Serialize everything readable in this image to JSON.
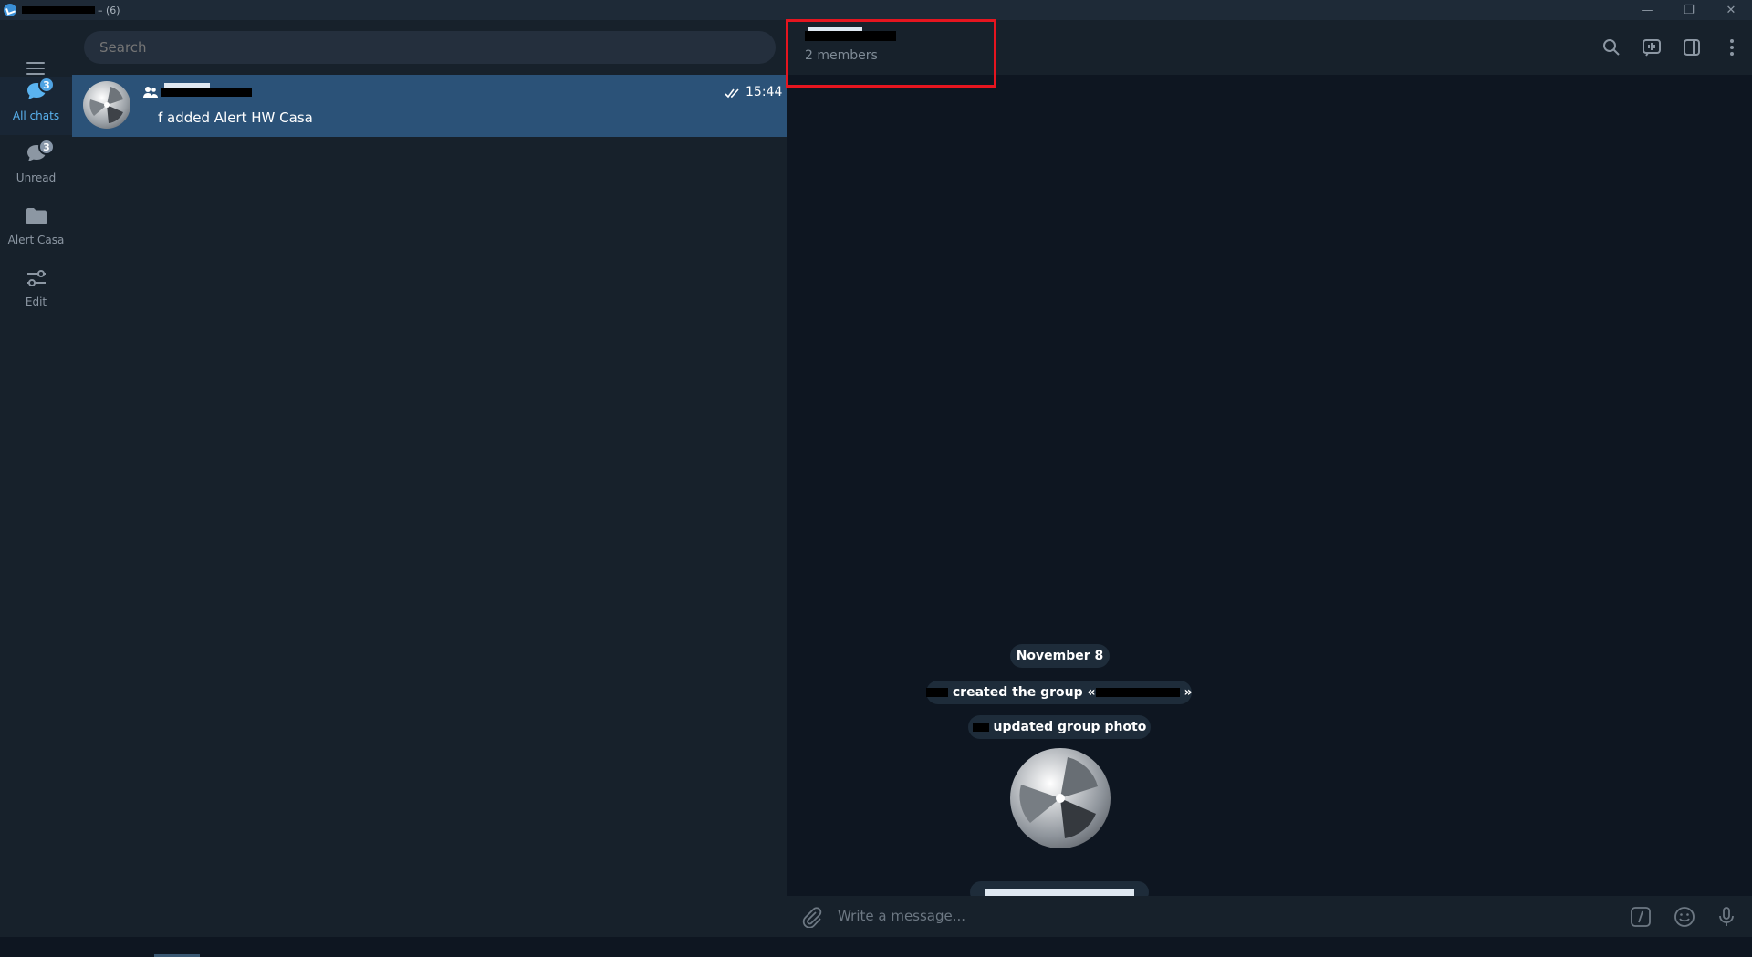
{
  "window": {
    "title_suffix": "– (6)",
    "controls": {
      "minimize": "—",
      "restore": "❐",
      "close": "✕"
    }
  },
  "folders": [
    {
      "label": "All chats",
      "badge": "3",
      "icon": "chats-icon",
      "active": true
    },
    {
      "label": "Unread",
      "badge": "3",
      "icon": "chat-bubble-icon",
      "active": false
    },
    {
      "label": "Alert Casa",
      "badge": "",
      "icon": "folder-icon",
      "active": false
    },
    {
      "label": "Edit",
      "badge": "",
      "icon": "sliders-icon",
      "active": false
    }
  ],
  "search": {
    "placeholder": "Search"
  },
  "chat_list": [
    {
      "time": "15:44",
      "preview": "f added Alert HW Casa",
      "read": true
    }
  ],
  "chat": {
    "members": "2 members",
    "date": "November 8",
    "service": {
      "created_text": "created the group «",
      "created_end": "»",
      "photo_text": "updated group photo"
    },
    "composer_placeholder": "Write a message..."
  },
  "colors": {
    "accent": "#5ab3f0",
    "selected_row": "#2b5278",
    "highlight": "#e5151f",
    "sidebar": "#17212b",
    "chat_bg": "#0e1621"
  }
}
